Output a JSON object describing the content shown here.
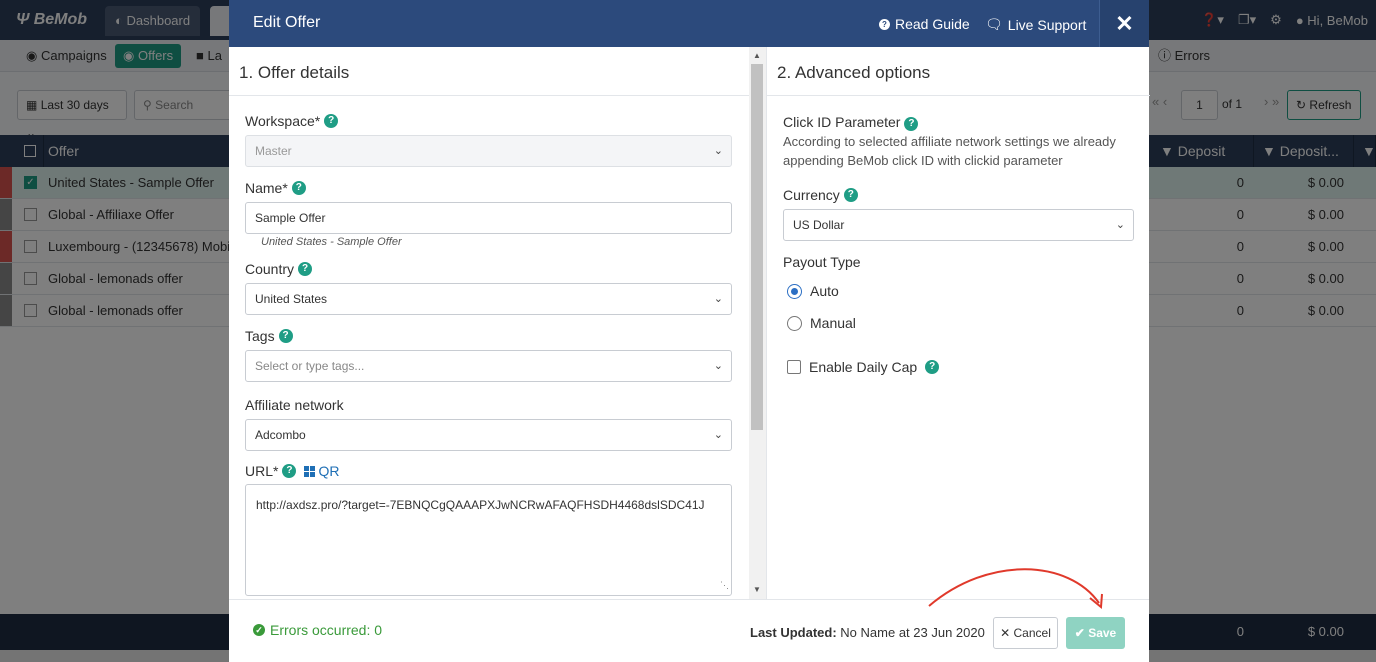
{
  "app": {
    "logo": "BeMob",
    "tabs": [
      {
        "label": "Dashboard"
      },
      {
        "label": ""
      }
    ],
    "user": "Hi, BeMob",
    "subnav": [
      "Campaigns",
      "Offers",
      "La",
      "Errors"
    ],
    "filters": {
      "date_range": "Last 30 days",
      "search_placeholder": "Search",
      "page": "1",
      "page_of": "of 1",
      "refresh": "Refresh"
    },
    "columns": {
      "offer": "Offer",
      "deposit": "Deposit",
      "deposit_amt": "Deposit..."
    },
    "rows": [
      {
        "name": "United States - Sample Offer",
        "deposit": "0",
        "amount": "$ 0.00",
        "stripe": "#d9534f",
        "selected": true
      },
      {
        "name": "Global - Affiliaxe Offer",
        "deposit": "0",
        "amount": "$ 0.00",
        "stripe": "#8a8a8a",
        "selected": false
      },
      {
        "name": "Luxembourg - (12345678) Mobi",
        "deposit": "0",
        "amount": "$ 0.00",
        "stripe": "#d9534f",
        "selected": false
      },
      {
        "name": "Global - lemonads offer",
        "deposit": "0",
        "amount": "$ 0.00",
        "stripe": "#8a8a8a",
        "selected": false
      },
      {
        "name": "Global - lemonads offer",
        "deposit": "0",
        "amount": "$ 0.00",
        "stripe": "#8a8a8a",
        "selected": false
      }
    ],
    "totals": {
      "deposit": "0",
      "amount": "$ 0.00"
    }
  },
  "modal": {
    "title": "Edit Offer",
    "read_guide": "Read Guide",
    "live_support": "Live Support",
    "left": {
      "section_title": "1. Offer details",
      "workspace_label": "Workspace*",
      "workspace_value": "Master",
      "name_label": "Name*",
      "name_value": "Sample Offer",
      "name_hint": "United States - Sample Offer",
      "country_label": "Country",
      "country_value": "United States",
      "tags_label": "Tags",
      "tags_placeholder": "Select or type tags...",
      "network_label": "Affiliate network",
      "network_value": "Adcombo",
      "url_label": "URL*",
      "qr_label": "QR",
      "url_value": "http://axdsz.pro/?target=-7EBNQCgQAAAPXJwNCRwAFAQFHSDH4468dslSDC41J"
    },
    "right": {
      "section_title": "2. Advanced options",
      "clickid_label": "Click ID Parameter",
      "clickid_desc": "According to selected affiliate network settings we already appending BeMob click ID with clickid parameter",
      "currency_label": "Currency",
      "currency_value": "US Dollar",
      "payout_label": "Payout Type",
      "payout_auto": "Auto",
      "payout_manual": "Manual",
      "daily_cap": "Enable Daily Cap"
    },
    "footer": {
      "errors": "Errors occurred: 0",
      "updated_label": "Last Updated:",
      "updated_value": "No Name at 23 Jun 2020",
      "cancel": "Cancel",
      "save": "Save"
    }
  },
  "colors": {
    "header": "#2c4a7c",
    "accent": "#1f9d85",
    "save_disabled": "#8fd3c2",
    "annotation": "#e0392b"
  }
}
